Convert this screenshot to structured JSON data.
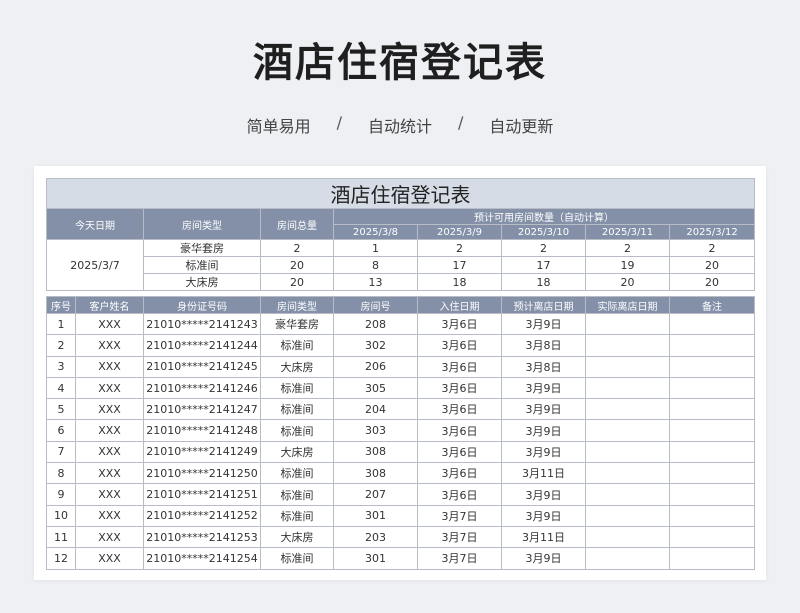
{
  "page": {
    "title": "酒店住宿登记表",
    "tags": [
      "简单易用",
      "自动统计",
      "自动更新"
    ],
    "separator": "/"
  },
  "sheet": {
    "title": "酒店住宿登记表",
    "summary_headers": {
      "today": "今天日期",
      "room_type": "房间类型",
      "room_total": "房间总量",
      "forecast": "预计可用房间数量（自动计算）"
    },
    "forecast_dates": [
      "2025/3/8",
      "2025/3/9",
      "2025/3/10",
      "2025/3/11",
      "2025/3/12"
    ],
    "today_value": "2025/3/7",
    "summary_rows": [
      {
        "type": "豪华套房",
        "total": "2",
        "avail": [
          "1",
          "2",
          "2",
          "2",
          "2"
        ]
      },
      {
        "type": "标准间",
        "total": "20",
        "avail": [
          "8",
          "17",
          "17",
          "19",
          "20"
        ]
      },
      {
        "type": "大床房",
        "total": "20",
        "avail": [
          "13",
          "18",
          "18",
          "20",
          "20"
        ]
      }
    ],
    "main_headers": [
      "序号",
      "客户姓名",
      "身份证号码",
      "房间类型",
      "房间号",
      "入住日期",
      "预计离店日期",
      "实际离店日期",
      "备注"
    ],
    "rows": [
      {
        "no": "1",
        "name": "XXX",
        "id": "21010*****2141243",
        "type": "豪华套房",
        "room": "208",
        "in": "3月6日",
        "out": "3月9日",
        "actual": "",
        "note": ""
      },
      {
        "no": "2",
        "name": "XXX",
        "id": "21010*****2141244",
        "type": "标准间",
        "room": "302",
        "in": "3月6日",
        "out": "3月8日",
        "actual": "",
        "note": ""
      },
      {
        "no": "3",
        "name": "XXX",
        "id": "21010*****2141245",
        "type": "大床房",
        "room": "206",
        "in": "3月6日",
        "out": "3月8日",
        "actual": "",
        "note": ""
      },
      {
        "no": "4",
        "name": "XXX",
        "id": "21010*****2141246",
        "type": "标准间",
        "room": "305",
        "in": "3月6日",
        "out": "3月9日",
        "actual": "",
        "note": ""
      },
      {
        "no": "5",
        "name": "XXX",
        "id": "21010*****2141247",
        "type": "标准间",
        "room": "204",
        "in": "3月6日",
        "out": "3月9日",
        "actual": "",
        "note": ""
      },
      {
        "no": "6",
        "name": "XXX",
        "id": "21010*****2141248",
        "type": "标准间",
        "room": "303",
        "in": "3月6日",
        "out": "3月9日",
        "actual": "",
        "note": ""
      },
      {
        "no": "7",
        "name": "XXX",
        "id": "21010*****2141249",
        "type": "大床房",
        "room": "308",
        "in": "3月6日",
        "out": "3月9日",
        "actual": "",
        "note": ""
      },
      {
        "no": "8",
        "name": "XXX",
        "id": "21010*****2141250",
        "type": "标准间",
        "room": "308",
        "in": "3月6日",
        "out": "3月11日",
        "actual": "",
        "note": ""
      },
      {
        "no": "9",
        "name": "XXX",
        "id": "21010*****2141251",
        "type": "标准间",
        "room": "207",
        "in": "3月6日",
        "out": "3月9日",
        "actual": "",
        "note": ""
      },
      {
        "no": "10",
        "name": "XXX",
        "id": "21010*****2141252",
        "type": "标准间",
        "room": "301",
        "in": "3月7日",
        "out": "3月9日",
        "actual": "",
        "note": ""
      },
      {
        "no": "11",
        "name": "XXX",
        "id": "21010*****2141253",
        "type": "大床房",
        "room": "203",
        "in": "3月7日",
        "out": "3月11日",
        "actual": "",
        "note": ""
      },
      {
        "no": "12",
        "name": "XXX",
        "id": "21010*****2141254",
        "type": "标准间",
        "room": "301",
        "in": "3月7日",
        "out": "3月9日",
        "actual": "",
        "note": ""
      }
    ]
  }
}
